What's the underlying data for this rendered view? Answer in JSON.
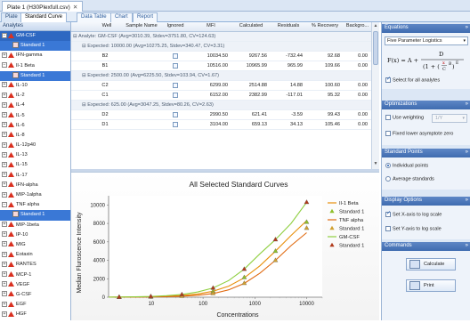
{
  "window": {
    "doc_tab": "Plate 1 (H30Plexfull.csv)"
  },
  "tabs": [
    "Plate",
    "Standard Curve",
    "Data Table",
    "Chart",
    "Report"
  ],
  "analytes_panel": {
    "title": "Analytes",
    "items": [
      {
        "label": "GM-CSF",
        "color": "#d93020",
        "selected": true
      },
      {
        "label": "Standard 1",
        "child": true,
        "selected": true
      },
      {
        "label": "IFN-gamma",
        "color": "#d93020"
      },
      {
        "label": "Il-1 Beta",
        "color": "#d93020"
      },
      {
        "label": "Standard 1",
        "child": true,
        "selected": true
      },
      {
        "label": "IL-10",
        "color": "#d93020"
      },
      {
        "label": "IL-2",
        "color": "#d93020"
      },
      {
        "label": "IL-4",
        "color": "#d93020"
      },
      {
        "label": "IL-5",
        "color": "#d93020"
      },
      {
        "label": "IL-6",
        "color": "#d93020"
      },
      {
        "label": "IL-8",
        "color": "#d93020"
      },
      {
        "label": "IL-12p40",
        "color": "#d93020"
      },
      {
        "label": "IL-13",
        "color": "#d93020"
      },
      {
        "label": "IL-15",
        "color": "#d93020"
      },
      {
        "label": "IL-17",
        "color": "#d93020"
      },
      {
        "label": "IFN-alpha",
        "color": "#d93020"
      },
      {
        "label": "MIP-1alpha",
        "color": "#d93020"
      },
      {
        "label": "TNF alpha",
        "color": "#d93020"
      },
      {
        "label": "Standard 1",
        "child": true,
        "selected": true
      },
      {
        "label": "MIP-1beta",
        "color": "#d93020"
      },
      {
        "label": "IP-10",
        "color": "#d93020"
      },
      {
        "label": "MIG",
        "color": "#d93020"
      },
      {
        "label": "Eotaxin",
        "color": "#d93020"
      },
      {
        "label": "RANTES",
        "color": "#d93020"
      },
      {
        "label": "MCP-1",
        "color": "#d93020"
      },
      {
        "label": "VEGF",
        "color": "#d93020"
      },
      {
        "label": "G-CSF",
        "color": "#d93020"
      },
      {
        "label": "EGF",
        "color": "#d93020"
      },
      {
        "label": "HGF",
        "color": "#d93020"
      }
    ]
  },
  "grid": {
    "headers": [
      "Well",
      "Sample Name",
      "Ignored",
      "MFI",
      "Calculated",
      "Residuals",
      "% Recovery",
      "Backgro..."
    ],
    "analyte_row": "Analyte: GM-CSF (Avg=3010.39, Stdev=3751.80, CV=124.63)",
    "groups": [
      {
        "label": "Expected: 10000.00 (Avg=10275.25, Stdev=340.47, CV=3.31)",
        "rows": [
          {
            "well": "B2",
            "mfi": "10034.50",
            "calc": "9267.56",
            "resid": "-732.44",
            "rec": "92.68",
            "bg": "0.00"
          },
          {
            "well": "B1",
            "mfi": "10516.00",
            "calc": "10965.99",
            "resid": "965.99",
            "rec": "109.66",
            "bg": "0.00"
          }
        ]
      },
      {
        "label": "Expected: 2500.00 (Avg=6225.50, Stdev=103.94, CV=1.67)",
        "rows": [
          {
            "well": "C2",
            "mfi": "6299.00",
            "calc": "2514.88",
            "resid": "14.88",
            "rec": "100.60",
            "bg": "0.00"
          },
          {
            "well": "C1",
            "mfi": "6152.00",
            "calc": "2382.99",
            "resid": "-117.01",
            "rec": "95.32",
            "bg": "0.00"
          }
        ]
      },
      {
        "label": "Expected: 625.00 (Avg=3047.25, Stdev=80.26, CV=2.63)",
        "rows": [
          {
            "well": "D2",
            "mfi": "2990.50",
            "calc": "621.41",
            "resid": "-3.59",
            "rec": "99.43",
            "bg": "0.00"
          },
          {
            "well": "D1",
            "mfi": "3104.00",
            "calc": "659.13",
            "resid": "34.13",
            "rec": "105.46",
            "bg": "0.00"
          }
        ]
      }
    ]
  },
  "chart_data": {
    "type": "scatter",
    "title": "All Selected Standard Curves",
    "xlabel": "Concentrations",
    "ylabel": "Median Fluroscence Intensity",
    "xscale": "log",
    "xlim": [
      1.5,
      20000
    ],
    "ylim": [
      0,
      11000
    ],
    "x_ticks": [
      "10",
      "100",
      "1000",
      "10000"
    ],
    "y_ticks": [
      "0",
      "2000",
      "4000",
      "6000",
      "8000",
      "10000"
    ],
    "legend_position": "right",
    "legend": [
      "Il-1 Beta",
      "Standard 1",
      "TNF alpha",
      "Standard 1",
      "GM-CSF",
      "Standard 1"
    ],
    "series": [
      {
        "name": "Il-1 Beta",
        "color": "#e8900c",
        "marker": "none",
        "x": [
          1.5,
          2.4,
          4.9,
          9.8,
          19.5,
          39,
          78,
          156,
          312,
          625,
          1250,
          2500,
          5000,
          10000
        ],
        "y": [
          5,
          10,
          25,
          50,
          95,
          180,
          350,
          650,
          1200,
          2100,
          3400,
          5000,
          6700,
          8300
        ]
      },
      {
        "name": "Standard 1",
        "color": "#8fbf2a",
        "marker": "triangle",
        "x": [
          2.4,
          9.8,
          39,
          156,
          625,
          2500,
          10000
        ],
        "y": [
          10,
          55,
          190,
          640,
          2150,
          5000,
          8150
        ]
      },
      {
        "name": "TNF alpha",
        "color": "#e06a10",
        "marker": "none",
        "x": [
          1.5,
          2.4,
          4.9,
          9.8,
          19.5,
          39,
          78,
          156,
          312,
          625,
          1250,
          2500,
          5000,
          10000
        ],
        "y": [
          3,
          6,
          15,
          30,
          60,
          110,
          210,
          400,
          800,
          1500,
          2600,
          4000,
          5600,
          7000
        ]
      },
      {
        "name": "Standard 1",
        "color": "#d0a030",
        "marker": "triangle",
        "x": [
          2.4,
          9.8,
          39,
          156,
          625,
          2500,
          10000
        ],
        "y": [
          7,
          35,
          120,
          420,
          1520,
          4000,
          7500
        ]
      },
      {
        "name": "GM-CSF",
        "color": "#8fcf40",
        "marker": "none",
        "x": [
          1.5,
          2.4,
          4.9,
          9.8,
          19.5,
          39,
          78,
          156,
          312,
          625,
          1250,
          2500,
          5000,
          10000
        ],
        "y": [
          8,
          15,
          40,
          80,
          160,
          300,
          560,
          1000,
          1800,
          3050,
          4700,
          6250,
          8000,
          10300
        ]
      },
      {
        "name": "Standard 1",
        "color": "#b03a1a",
        "marker": "triangle",
        "x": [
          2.4,
          9.8,
          39,
          156,
          625,
          2500,
          10000
        ],
        "y": [
          15,
          85,
          300,
          1000,
          3050,
          6250,
          10300
        ]
      }
    ]
  },
  "right_panel": {
    "equations": {
      "title": "Equations",
      "model": "Five Parameter Logistics",
      "formula_prefix": "F(x) = A +",
      "formula_num": "D",
      "formula_den": "(1 + (",
      "formula_frac_x": "x",
      "formula_frac_c": "C",
      "formula_exp": "B",
      "formula_exp2": "E",
      "select_all": "Select for all analytes"
    },
    "optimizations": {
      "title": "Optimizations",
      "use_weighting": "Use weighting",
      "weighting_value": "1/Y",
      "fixed_lower": "Fixed lower asymptote zero"
    },
    "standard_points": {
      "title": "Standard Points",
      "individual": "Individual points",
      "average": "Average standards"
    },
    "display_options": {
      "title": "Display Options",
      "x_log": "Set X-axis to log scale",
      "y_log": "Set Y-axis to log scale"
    },
    "commands": {
      "title": "Commands",
      "calculate": "Calculate",
      "print": "Print"
    }
  }
}
